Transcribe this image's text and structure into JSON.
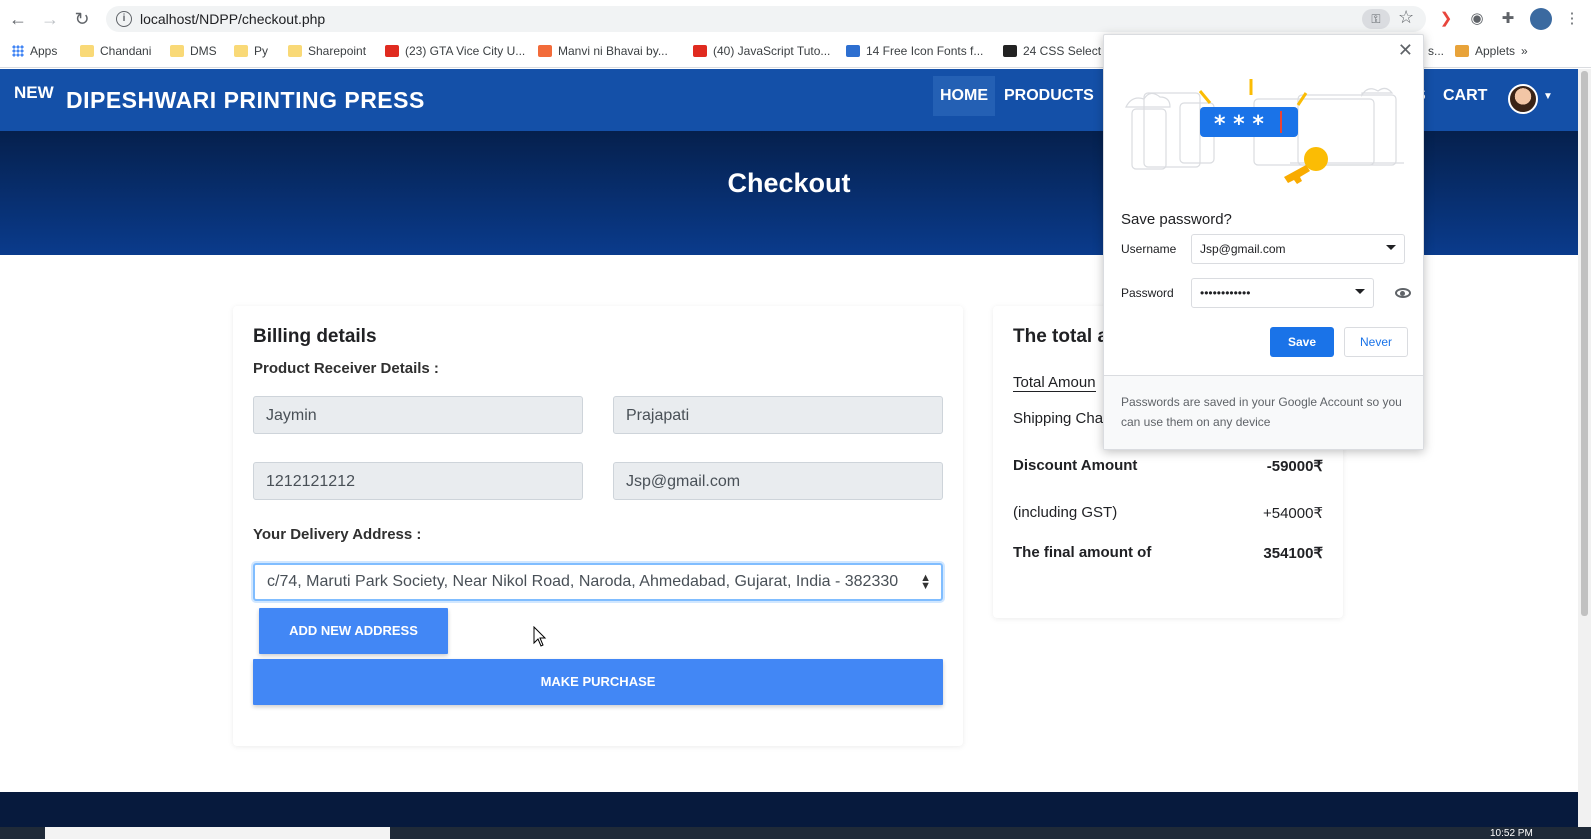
{
  "browser": {
    "url": "localhost/NDPP/checkout.php",
    "back_icon": "arrow-left-icon",
    "forward_icon": "arrow-right-icon",
    "reload_icon": "reload-icon",
    "bookmarks": [
      {
        "label": "Apps",
        "icon": "apps-grid-icon"
      },
      {
        "label": "Chandani",
        "icon": "folder-icon"
      },
      {
        "label": "DMS",
        "icon": "folder-icon"
      },
      {
        "label": "Py",
        "icon": "folder-icon"
      },
      {
        "label": "Sharepoint",
        "icon": "folder-icon"
      },
      {
        "label": "(23) GTA Vice City U...",
        "icon": "youtube-icon"
      },
      {
        "label": "Manvi ni Bhavai by...",
        "icon": "site-icon"
      },
      {
        "label": "(40) JavaScript Tuto...",
        "icon": "youtube-icon"
      },
      {
        "label": "14 Free Icon Fonts f...",
        "icon": "site-icon"
      },
      {
        "label": "24 CSS Select E",
        "icon": "site-icon"
      },
      {
        "label": "s...",
        "icon": "site-icon"
      },
      {
        "label": "Applets",
        "icon": "site-icon"
      },
      {
        "label": "»",
        "icon": ""
      }
    ]
  },
  "site": {
    "brand_new": "NEW",
    "brand": "DIPESHWARI PRINTING PRESS",
    "nav": {
      "home": "HOME",
      "products": "PRODUCTS",
      "s": "S",
      "cart": "CART"
    }
  },
  "hero": {
    "title": "Checkout"
  },
  "billing": {
    "title": "Billing details",
    "receiver_label": "Product Receiver Details :",
    "first_name": "Jaymin",
    "last_name": "Prajapati",
    "phone": "1212121212",
    "email": "Jsp@gmail.com",
    "address_label": "Your Delivery Address :",
    "address": "c/74, Maruti Park Society, Near Nikol Road, Naroda, Ahmedabad, Gujarat, India - 382330",
    "add_address_button": "ADD NEW ADDRESS",
    "purchase_button": "MAKE PURCHASE"
  },
  "totals": {
    "title": "The total a",
    "rows": [
      {
        "label": "Total Amoun",
        "value": ""
      },
      {
        "label": "Shipping Cha",
        "value": ""
      },
      {
        "label": "Discount Amount",
        "value": "-59000₹"
      },
      {
        "label": "(including GST)",
        "value": "+54000₹"
      },
      {
        "label": "The final amount of",
        "value": "354100₹"
      }
    ]
  },
  "password_popup": {
    "title": "Save password?",
    "username_label": "Username",
    "username_value": "Jsp@gmail.com",
    "password_label": "Password",
    "password_value": "••••••••••••",
    "save_button": "Save",
    "never_button": "Never",
    "footer_text": "Passwords are saved in your Google Account so you can use them on any device",
    "illustration_stars": "* * *",
    "close": "✕"
  },
  "taskbar": {
    "clock": "10:52 PM"
  },
  "colors": {
    "nav_blue": "#1450a8",
    "hero_dark": "#05204d",
    "button_blue": "#4287f5",
    "google_blue": "#1a73e8"
  }
}
